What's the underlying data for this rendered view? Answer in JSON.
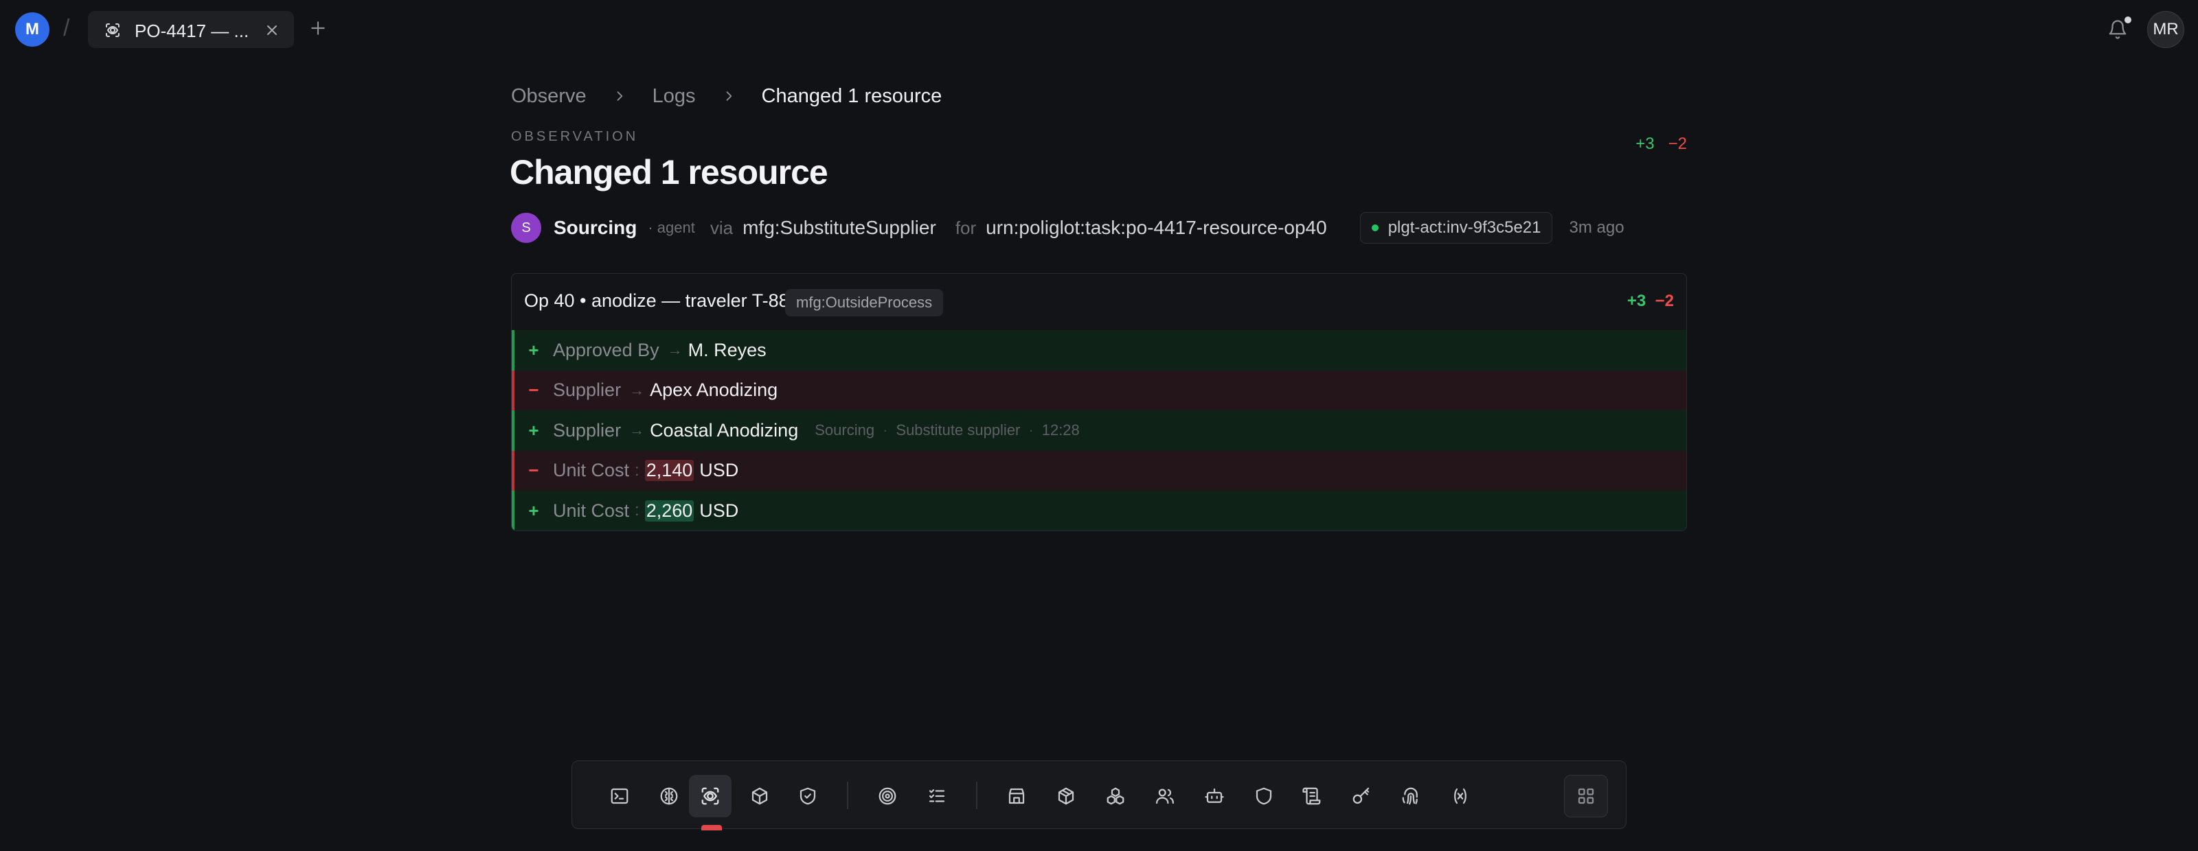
{
  "topbar": {
    "workspace_initial": "M",
    "tab_title": "PO-4417 — ...",
    "user_initials": "MR"
  },
  "breadcrumb": [
    "Observe",
    "Logs",
    "Changed 1 resource"
  ],
  "header": {
    "eyebrow": "OBSERVATION",
    "title": "Changed 1 resource",
    "additions": "+3",
    "deletions": "−2"
  },
  "meta": {
    "actor_initial": "S",
    "actor_name": "Sourcing",
    "actor_kind": "· agent",
    "via_label": "via",
    "via_value": "mfg:SubstituteSupplier",
    "for_label": "for",
    "for_value": "urn:poliglot:task:po-4417-resource-op40",
    "activity_id": "plgt-act:inv-9f3c5e21",
    "time_ago": "3m ago"
  },
  "resource": {
    "title": "Op 40 • anodize — traveler T-88",
    "type": "mfg:OutsideProcess",
    "additions": "+3",
    "deletions": "−2",
    "rows": [
      {
        "sign": "+",
        "field": "Approved By",
        "value": "M. Reyes"
      },
      {
        "sign": "−",
        "field": "Supplier",
        "value": "Apex Anodizing"
      },
      {
        "sign": "+",
        "field": "Supplier",
        "value": "Coastal Anodizing",
        "note_actor": "Sourcing",
        "note_text": "Substitute supplier",
        "note_time": "12:28"
      },
      {
        "sign": "−",
        "field": "Unit Cost",
        "amount": "2,140",
        "unit": "USD"
      },
      {
        "sign": "+",
        "field": "Unit Cost",
        "amount": "2,260",
        "unit": "USD"
      }
    ]
  },
  "icons": {
    "tab": "observe-icon",
    "dock": [
      "terminal-icon",
      "brain-icon",
      "observe-icon",
      "box-icon",
      "shield-check-icon",
      "target-icon",
      "checklist-icon",
      "store-icon",
      "package-icon",
      "boxes-icon",
      "users-icon",
      "bot-icon",
      "shield-icon",
      "scroll-icon",
      "key-icon",
      "fingerprint-icon",
      "variable-icon",
      "grid-icon"
    ]
  },
  "colors": {
    "background": "#111215",
    "addition": "#3ec46d",
    "deletion": "#ef4b4b",
    "workspace_avatar": "#2f6ae8",
    "actor_avatar": "#8c3ec8",
    "active_indicator": "#e0484a"
  }
}
